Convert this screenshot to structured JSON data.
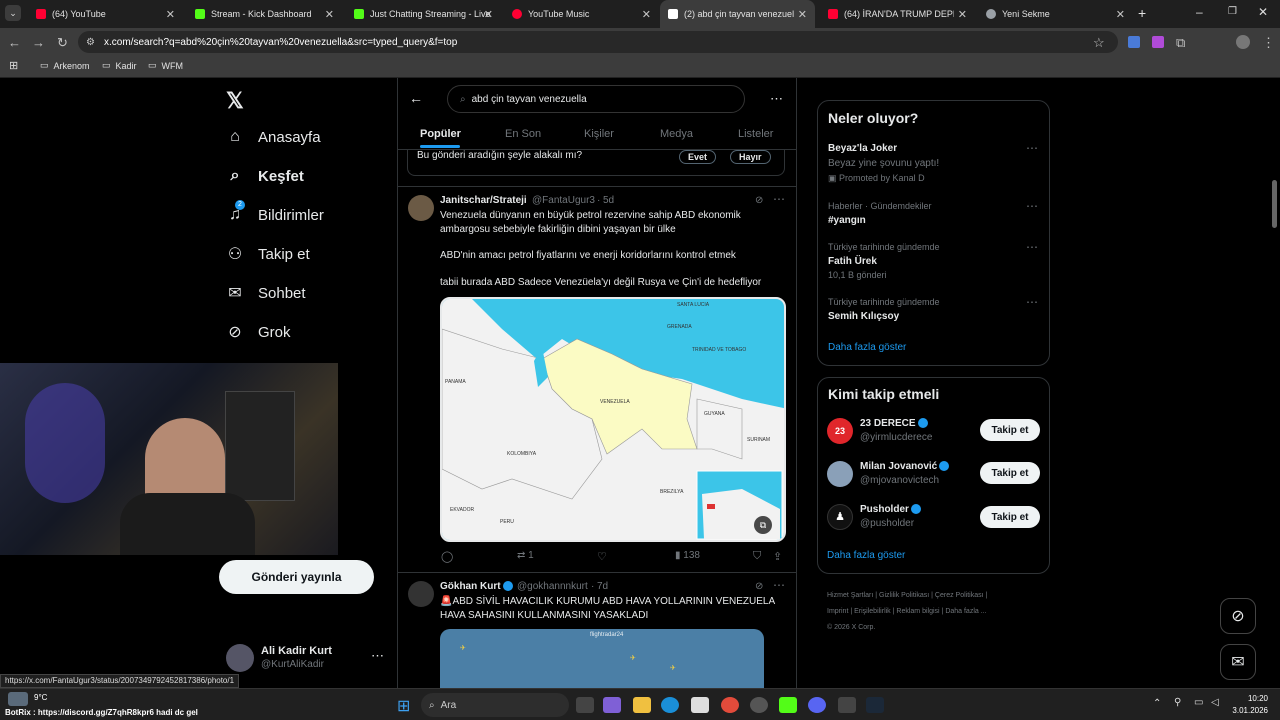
{
  "browser": {
    "tabs": [
      {
        "label": "(64) YouTube",
        "color": "#ff0033"
      },
      {
        "label": "Stream - Kick Dashboard",
        "color": "#53fc18"
      },
      {
        "label": "Just Chatting Streaming - Live",
        "color": "#53fc18"
      },
      {
        "label": "YouTube Music",
        "color": "#ff0033"
      },
      {
        "label": "(2) abd çin tayvan venezuela -",
        "color": "#ffffff"
      },
      {
        "label": "(64) İRAN'DA TRUMP DEPREMİ",
        "color": "#ff0033"
      },
      {
        "label": "Yeni Sekme",
        "color": "#9aa0a6"
      }
    ],
    "url": "x.com/search?q=abd%20çin%20tayvan%20venezuella&src=typed_query&f=top",
    "bookmarks": [
      "Arkenom",
      "Kadir",
      "WFM"
    ]
  },
  "nav": {
    "items": [
      {
        "label": "Anasayfa",
        "icon": "home-icon"
      },
      {
        "label": "Keşfet",
        "icon": "search-icon"
      },
      {
        "label": "Bildirimler",
        "icon": "bell-icon",
        "badge": "2"
      },
      {
        "label": "Takip et",
        "icon": "add-user-icon"
      },
      {
        "label": "Sohbet",
        "icon": "mail-icon"
      },
      {
        "label": "Grok",
        "icon": "grok-icon"
      }
    ],
    "post_button": "Gönderi yayınla",
    "profile": {
      "name": "Ali Kadir Kurt",
      "handle": "@KurtAliKadir"
    }
  },
  "search": {
    "query": "abd çin tayvan venezuella",
    "tabs": [
      "Popüler",
      "En Son",
      "Kişiler",
      "Medya",
      "Listeler"
    ],
    "feedback": {
      "question": "Bu gönderi aradığın şeyle alakalı mı?",
      "yes": "Evet",
      "no": "Hayır"
    }
  },
  "tweets": [
    {
      "author": "Janitschar/Strateji",
      "handle": "@FantaUgur3",
      "time": "5d",
      "lines": [
        "Venezuela dünyanın en büyük petrol rezervine sahip ABD ekonomik",
        "ambargosu sebebiyle fakirliğin dibini yaşayan bir ülke",
        "ABD'nin amacı petrol fiyatlarını ve enerji koridorlarını kontrol etmek",
        "tabii burada ABD Sadece Venezüela'yı değil Rusya ve Çin'i de hedefliyor"
      ],
      "map_labels": [
        "GRENADA",
        "SANTA LUCIA",
        "TRINIDAD VE TOBAGO",
        "PANAMA",
        "VENEZUELA",
        "GUYANA",
        "SURINAM",
        "KOLOMBIYA",
        "EKVADOR",
        "PERU",
        "BREZILYA"
      ],
      "stats": {
        "retweets": "1",
        "views": "138"
      }
    },
    {
      "author": "Gökhan Kurt",
      "handle": "@gokhannnkurt",
      "time": "7d",
      "lines": [
        "🚨ABD SİVİL HAVACILIK KURUMU ABD HAVA YOLLARININ VENEZUELA",
        "HAVA SAHASINI KULLANMASINI YASAKLADI"
      ],
      "image_label": "flightradar24"
    }
  ],
  "trends": {
    "title": "Neler oluyor?",
    "items": [
      {
        "title": "Beyaz'la Joker",
        "sub": "Beyaz yine şovunu yaptı!",
        "meta": "Promoted by Kanal D"
      },
      {
        "context": "Haberler · Gündemdekiler",
        "title": "#yangın"
      },
      {
        "context": "Türkiye tarihinde gündemde",
        "title": "Fatih Ürek",
        "meta": "10,1 B gönderi"
      },
      {
        "context": "Türkiye tarihinde gündemde",
        "title": "Semih Kılıçsoy"
      }
    ],
    "more": "Daha fazla göster"
  },
  "who_to_follow": {
    "title": "Kimi takip etmeli",
    "users": [
      {
        "name": "23 DERECE",
        "handle": "@yirmlucderece",
        "button": "Takip et"
      },
      {
        "name": "Milan Jovanović",
        "handle": "@mjovanovictech",
        "button": "Takip et"
      },
      {
        "name": "Pusholder",
        "handle": "@pusholder",
        "button": "Takip et"
      }
    ],
    "more": "Daha fazla göster"
  },
  "footer": {
    "links": [
      "Hizmet Şartları",
      "Gizlilik Politikası",
      "Çerez Politikası",
      "Imprint",
      "Erişilebilirlik",
      "Reklam bilgisi",
      "Daha fazla ..."
    ],
    "copyright": "© 2026 X Corp."
  },
  "status_url": "https://x.com/FantaUgur3/status/2007349792452817386/photo/1",
  "overlay_text": "BotRix : https://discord.gg/Z7qhR8kpr6 hadi dc gel",
  "taskbar": {
    "search": "Ara",
    "weather": "9°C",
    "time": "10:20",
    "date": "3.01.2026"
  }
}
